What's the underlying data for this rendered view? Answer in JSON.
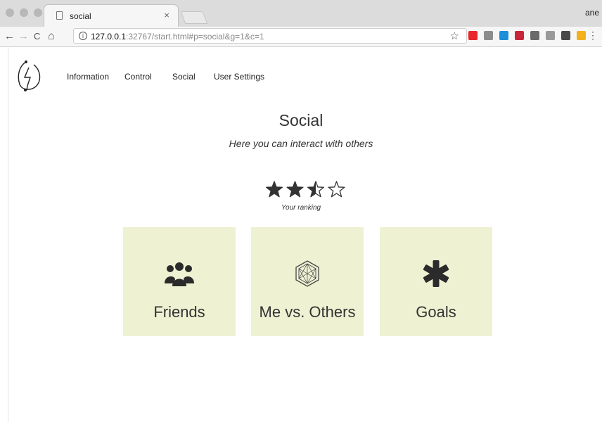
{
  "browser": {
    "tab_title": "social",
    "tab_close": "×",
    "profile_name": "ane",
    "nav": {
      "back": "←",
      "forward": "→",
      "reload": "C",
      "home": "⌂"
    },
    "url_host": "127.0.0.1",
    "url_rest": ":32767/start.html#p=social&g=1&c=1",
    "info_symbol": "i",
    "bookmark_star": "☆",
    "menu": "⋮",
    "extensions": [
      {
        "name": "opera-icon",
        "color": "#e8242c"
      },
      {
        "name": "camera-icon",
        "color": "#8c8c8c"
      },
      {
        "name": "trello-icon",
        "color": "#1c8fd8"
      },
      {
        "name": "mendeley-icon",
        "color": "#c8253a"
      },
      {
        "name": "pocket-icon",
        "color": "#6a6a6a"
      },
      {
        "name": "page-icon",
        "color": "#9a9a9a"
      },
      {
        "name": "evernote-icon",
        "color": "#4a4a4a"
      },
      {
        "name": "hand-icon",
        "color": "#f2b11d"
      }
    ]
  },
  "app": {
    "nav_items": [
      "Information",
      "Control",
      "Social",
      "User Settings"
    ],
    "title": "Social",
    "subtitle": "Here you can interact with others",
    "rating": {
      "value": 2.5,
      "max": 4,
      "label": "Your ranking"
    },
    "cards": [
      {
        "label": "Friends",
        "icon": "group-icon"
      },
      {
        "label": "Me vs. Others",
        "icon": "hexagon-network-icon"
      },
      {
        "label": "Goals",
        "icon": "asterisk-icon"
      }
    ],
    "colors": {
      "card_bg": "#eef2d3",
      "text": "#333333"
    }
  }
}
